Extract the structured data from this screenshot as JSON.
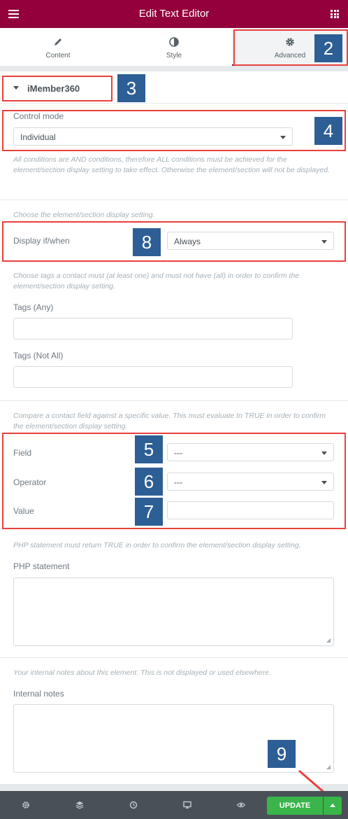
{
  "header": {
    "title": "Edit Text Editor"
  },
  "tabs": [
    {
      "label": "Content",
      "icon": "pencil-icon"
    },
    {
      "label": "Style",
      "icon": "half-circle-icon"
    },
    {
      "label": "Advanced",
      "icon": "gear-icon",
      "active": true
    }
  ],
  "section": {
    "title": "iMember360"
  },
  "control_mode": {
    "label": "Control mode",
    "value": "Individual"
  },
  "descriptions": {
    "and_conditions": "All conditions are AND conditions, therefore ALL conditions must be achieved for the element/section display setting to take effect. Otherwise the element/section will not be displayed.",
    "display_setting": "Choose the element/section display setting.",
    "tags": "Choose tags a contact must (at least one) and must not have (all) in order to confirm the element/section display setting.",
    "field_compare": "Compare a contact field against a specific value. This must evaluate to TRUE in order to confirm the element/section display setting.",
    "php": "PHP statement must return TRUE in order to confirm the element/section display setting.",
    "notes": "Your internal notes about this element. This is not displayed or used elsewhere."
  },
  "display": {
    "label": "Display if/when",
    "value": "Always"
  },
  "tags_any": {
    "label": "Tags (Any)",
    "value": ""
  },
  "tags_not_all": {
    "label": "Tags (Not All)",
    "value": ""
  },
  "field": {
    "label": "Field",
    "value": "---"
  },
  "operator": {
    "label": "Operator",
    "value": "---"
  },
  "value_field": {
    "label": "Value",
    "value": ""
  },
  "php_statement": {
    "label": "PHP statement",
    "value": ""
  },
  "internal_notes": {
    "label": "Internal notes",
    "value": ""
  },
  "footer": {
    "update_label": "UPDATE"
  },
  "badges": [
    "2",
    "3",
    "4",
    "8",
    "5",
    "6",
    "7",
    "9"
  ],
  "colors": {
    "header": "#93003c",
    "highlight": "#e8413e",
    "badge": "#2d5e95",
    "update": "#39b54a",
    "footer": "#495157"
  }
}
